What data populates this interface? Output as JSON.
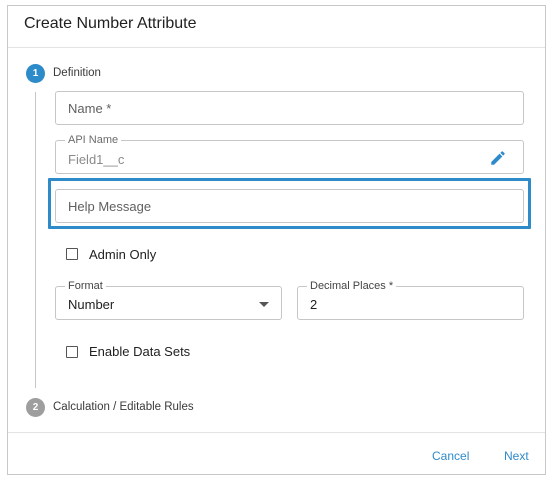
{
  "dialog": {
    "title": "Create Number Attribute"
  },
  "steps": [
    {
      "number": "1",
      "label": "Definition",
      "active": true
    },
    {
      "number": "2",
      "label": "Calculation / Editable Rules",
      "active": false
    }
  ],
  "form": {
    "name": {
      "placeholder": "Name *"
    },
    "api_name": {
      "legend": "API Name",
      "value": "Field1__c"
    },
    "help_message": {
      "placeholder": "Help Message"
    },
    "admin_only": {
      "label": "Admin Only",
      "checked": false
    },
    "format": {
      "legend": "Format",
      "value": "Number"
    },
    "decimal_places": {
      "legend": "Decimal Places *",
      "value": "2"
    },
    "enable_data_sets": {
      "label": "Enable Data Sets",
      "checked": false
    }
  },
  "footer": {
    "cancel_label": "Cancel",
    "next_label": "Next"
  },
  "colors": {
    "accent": "#2e8bc9",
    "step_active": "#2e8bc9",
    "step_inactive": "#9e9e9e"
  },
  "icons": {
    "edit": "pencil-icon",
    "dropdown": "caret-down-icon"
  }
}
